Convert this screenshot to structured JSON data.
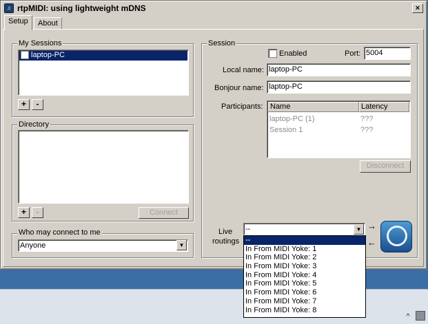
{
  "window": {
    "title": "rtpMIDI: using lightweight mDNS",
    "close": "×"
  },
  "tabs": [
    {
      "label": "Setup"
    },
    {
      "label": "About"
    }
  ],
  "my_sessions": {
    "label": "My Sessions",
    "items": [
      {
        "label": "laptop-PC",
        "checked": false
      }
    ],
    "add": "+",
    "remove": "-"
  },
  "directory": {
    "label": "Directory",
    "add": "+",
    "remove": "-",
    "connect": "Connect"
  },
  "who_may_connect": {
    "label": "Who may connect to me",
    "value": "Anyone"
  },
  "session": {
    "label": "Session",
    "enabled_label": "Enabled",
    "port_label": "Port:",
    "port": "5004",
    "local_name_label": "Local name:",
    "local_name": "laptop-PC",
    "bonjour_name_label": "Bonjour name:",
    "bonjour_name": "laptop-PC",
    "participants_label": "Participants:",
    "columns": {
      "name": "Name",
      "latency": "Latency"
    },
    "participants": [
      {
        "name": "laptop-PC (1)",
        "latency": "???"
      },
      {
        "name": "Session 1",
        "latency": "???"
      }
    ],
    "disconnect": "Disconnect",
    "live_routings_label_1": "Live",
    "live_routings_label_2": "routings",
    "routing_value": "--"
  },
  "routing_options": [
    "--",
    "In From MIDI Yoke:  1",
    "In From MIDI Yoke:  2",
    "In From MIDI Yoke:  3",
    "In From MIDI Yoke:  4",
    "In From MIDI Yoke:  5",
    "In From MIDI Yoke:  6",
    "In From MIDI Yoke:  7",
    "In From MIDI Yoke:  8"
  ],
  "arrows": {
    "right": "→",
    "left": "←"
  },
  "taskbar": {
    "tray_chevron": "^"
  }
}
